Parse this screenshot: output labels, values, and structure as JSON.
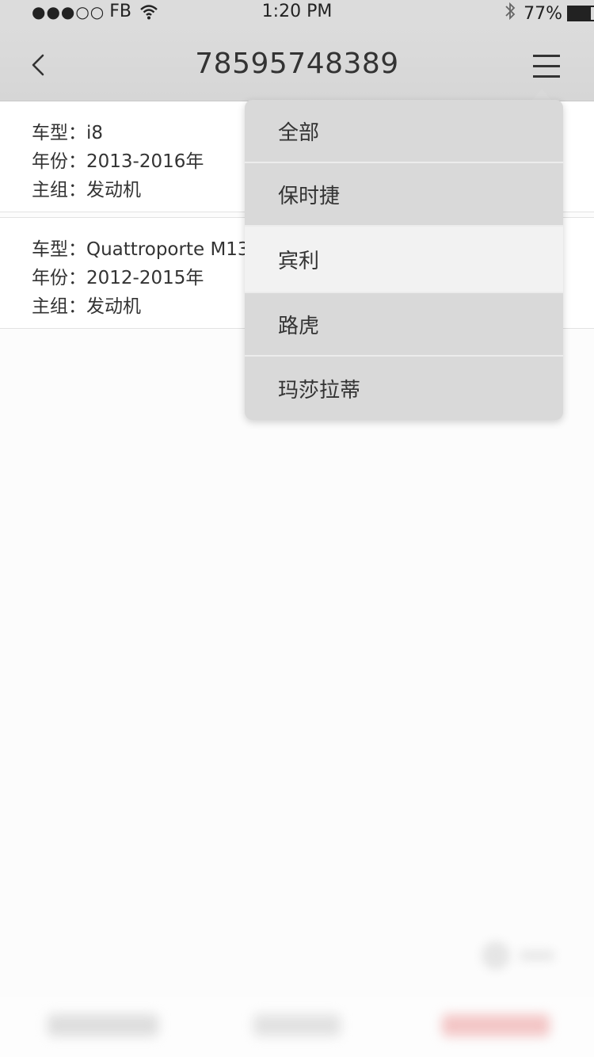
{
  "status_bar": {
    "signal": "●●●○○",
    "carrier": "FB",
    "time": "1:20 PM",
    "battery_percent": "77%",
    "bluetooth_icon": "bluetooth-icon",
    "wifi_icon": "wifi-icon"
  },
  "nav": {
    "title": "78595748389",
    "back_icon": "chevron-left-icon",
    "menu_icon": "hamburger-menu-icon"
  },
  "cards": [
    {
      "model": "车型：i8",
      "year": "年份：2013-2016年",
      "group": "主组：发动机"
    },
    {
      "model": "车型：Quattroporte M13",
      "year": "年份：2012-2015年",
      "group": "主组：发动机"
    }
  ],
  "dropdown": {
    "items": [
      {
        "label": "全部"
      },
      {
        "label": "保时捷"
      },
      {
        "label": "宾利",
        "selected": true
      },
      {
        "label": "路虎"
      },
      {
        "label": "玛莎拉蒂"
      }
    ]
  },
  "colors": {
    "nav_background": "#d9d9d9",
    "dropdown_background": "#d9d9d9",
    "dropdown_selected": "#f2f2f2",
    "page_background": "#fcfcfc"
  }
}
